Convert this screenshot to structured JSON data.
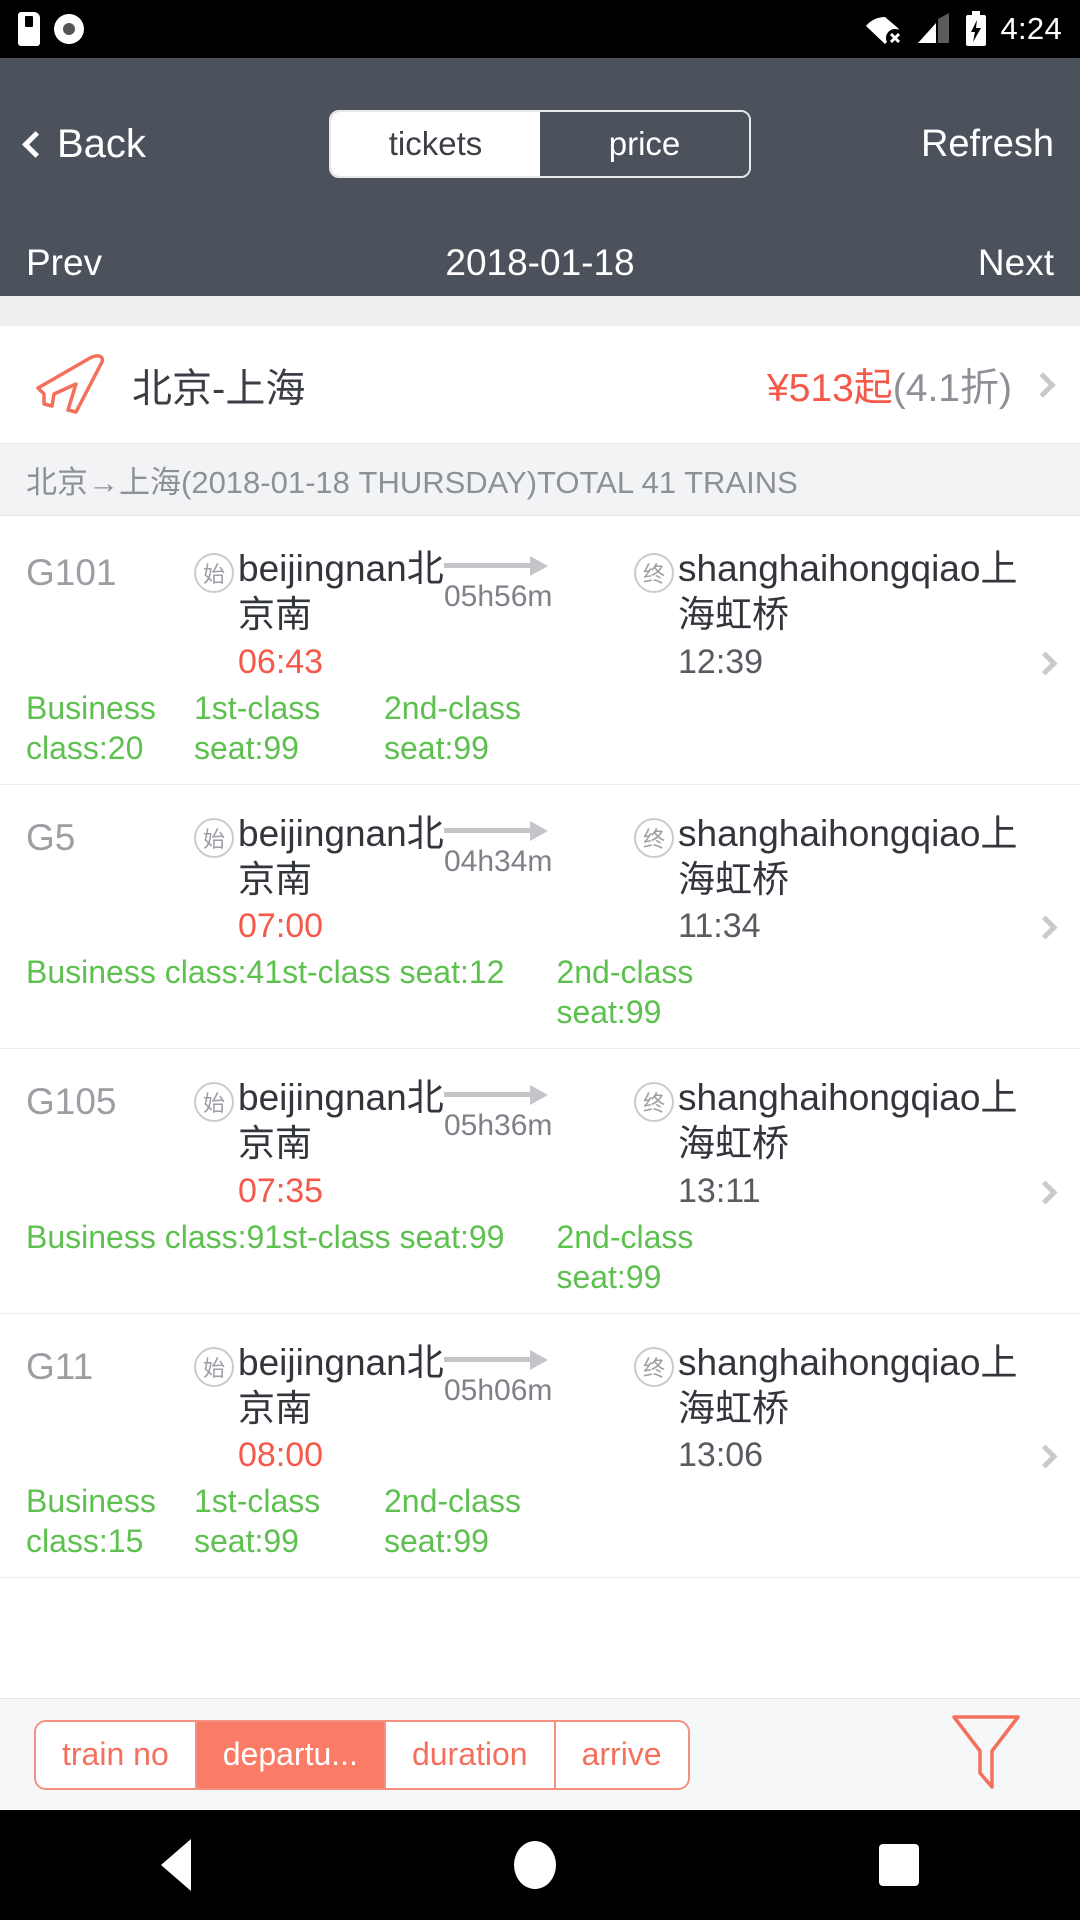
{
  "statusbar": {
    "time": "4:24",
    "icons": [
      "sd-card-icon",
      "disc-icon",
      "wifi-off-icon",
      "cellular-signal-icon",
      "battery-charging-icon"
    ]
  },
  "navbar": {
    "back_label": "Back",
    "refresh_label": "Refresh",
    "segments": [
      {
        "label": "tickets",
        "active": true
      },
      {
        "label": "price",
        "active": false
      }
    ]
  },
  "datebar": {
    "prev_label": "Prev",
    "date": "2018-01-18",
    "next_label": "Next"
  },
  "promo": {
    "icon": "airplane-icon",
    "route": "北京-上海",
    "price": "¥513起",
    "discount": "(4.1折)"
  },
  "summary": {
    "text": "北京→上海(2018-01-18 THURSDAY)TOTAL 41 TRAINS"
  },
  "sortbar": {
    "buttons": [
      {
        "label": "train no",
        "active": false
      },
      {
        "label": "departu...",
        "active": true
      },
      {
        "label": "duration",
        "active": false
      },
      {
        "label": "arrive",
        "active": false
      }
    ],
    "filter_icon": "funnel-filter-icon"
  },
  "list": {
    "from_badge": "始",
    "to_badge": "终",
    "trains": [
      {
        "no": "G101",
        "from_station": "beijingnan北京南",
        "to_station": "shanghaihongqiao上海虹桥",
        "depart": "06:43",
        "arrive": "12:39",
        "duration": "05h56m",
        "seats": [
          "Business class:20",
          "1st-class seat:99",
          "2nd-class seat:99"
        ],
        "tight": false
      },
      {
        "no": "G5",
        "from_station": "beijingnan北京南",
        "to_station": "shanghaihongqiao上海虹桥",
        "depart": "07:00",
        "arrive": "11:34",
        "duration": "04h34m",
        "seats": [
          "Business class:4",
          "1st-class seat:12",
          "2nd-class seat:99"
        ],
        "tight": true
      },
      {
        "no": "G105",
        "from_station": "beijingnan北京南",
        "to_station": "shanghaihongqiao上海虹桥",
        "depart": "07:35",
        "arrive": "13:11",
        "duration": "05h36m",
        "seats": [
          "Business class:9",
          "1st-class seat:99",
          "2nd-class seat:99"
        ],
        "tight": true
      },
      {
        "no": "G11",
        "from_station": "beijingnan北京南",
        "to_station": "shanghaihongqiao上海虹桥",
        "depart": "08:00",
        "arrive": "13:06",
        "duration": "05h06m",
        "seats": [
          "Business class:15",
          "1st-class seat:99",
          "2nd-class seat:99"
        ],
        "tight": false
      }
    ]
  },
  "androidnav": {
    "buttons": [
      "back-nav-icon",
      "home-nav-icon",
      "recents-nav-icon"
    ]
  },
  "colors": {
    "accent": "#f4594a",
    "header": "#4c525c",
    "available": "#5dc04f",
    "sort_accent": "#fa7b66"
  }
}
